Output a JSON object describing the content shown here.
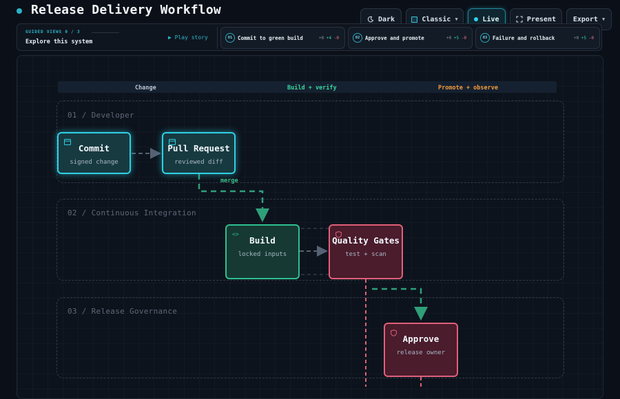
{
  "header": {
    "title": "Release Delivery Workflow",
    "buttons": {
      "theme": "Dark",
      "style": "Classic",
      "live": "Live",
      "present": "Present",
      "export": "Export"
    }
  },
  "guided": {
    "label": "GUIDED VIEWS 0 / 3",
    "subtitle": "Explore this system",
    "play": "▶ Play story",
    "steps": [
      {
        "num": "01",
        "label": "Commit to green build",
        "count": "+0",
        "added": "+4",
        "removed": "-0"
      },
      {
        "num": "02",
        "label": "Approve and promote",
        "count": "+0",
        "added": "+5",
        "removed": "-0"
      },
      {
        "num": "03",
        "label": "Failure and rollback",
        "count": "+0",
        "added": "+5",
        "removed": "-0"
      }
    ]
  },
  "phases": [
    "Change",
    "Build + verify",
    "Promote + observe"
  ],
  "lanes": [
    "01 / Developer",
    "02 / Continuous Integration",
    "03 / Release Governance"
  ],
  "nodes": {
    "commit": {
      "title": "Commit",
      "subtitle": "signed change"
    },
    "pull_request": {
      "title": "Pull Request",
      "subtitle": "reviewed diff"
    },
    "build": {
      "title": "Build",
      "subtitle": "locked inputs"
    },
    "quality_gates": {
      "title": "Quality Gates",
      "subtitle": "test + scan"
    },
    "approve": {
      "title": "Approve",
      "subtitle": "release owner"
    }
  },
  "edge_labels": {
    "merge": "merge"
  },
  "colors": {
    "accent_cyan": "#2fd0e4",
    "accent_green": "#2fbf8f",
    "accent_red": "#e0607a",
    "phase_change": "#b8c4d0",
    "phase_build": "#3ad6a0",
    "phase_promote": "#f39a3c"
  },
  "icons": {
    "theme": "moon-icon",
    "style": "palette-icon",
    "live": "live-dot-icon",
    "present": "fullscreen-icon",
    "export": "chevron-down-icon"
  }
}
